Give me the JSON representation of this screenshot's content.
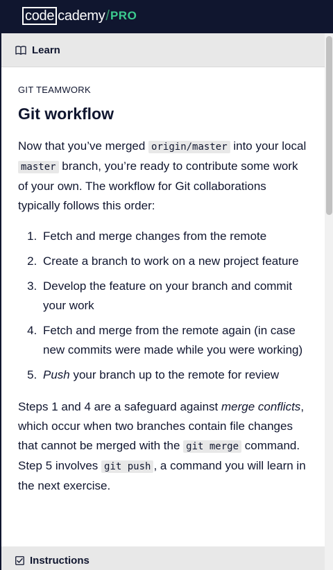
{
  "header": {
    "logo_code": "code",
    "logo_cademy": "cademy",
    "logo_slash": "/",
    "logo_pro": "PRO"
  },
  "learn_bar": {
    "label": "Learn",
    "icon": "book-icon"
  },
  "article": {
    "kicker": "GIT TEAMWORK",
    "title": "Git workflow",
    "intro": {
      "t1": "Now that you’ve merged ",
      "c1": "origin/master",
      "t2": " into your local ",
      "c2": "master",
      "t3": " branch, you’re ready to contribute some work of your own. The workflow for Git collaborations typically follows this order:"
    },
    "steps": [
      "Fetch and merge changes from the remote",
      "Create a branch to work on a new project feature",
      "Develop the feature on your branch and commit your work",
      "Fetch and merge from the remote again (in case new commits were made while you were working)"
    ],
    "step5": {
      "em": "Push",
      "rest": " your branch up to the remote for review"
    },
    "outro": {
      "t1": "Steps 1 and 4 are a safeguard against ",
      "em1": "merge conflicts",
      "t2": ", which occur when two branches contain file changes that cannot be merged with the ",
      "c1": "git merge",
      "t3": " command. Step 5 involves ",
      "c2": "git push",
      "t4": ", a command you will learn in the next exercise."
    }
  },
  "instructions_bar": {
    "label": "Instructions",
    "icon": "checkbox-icon"
  }
}
